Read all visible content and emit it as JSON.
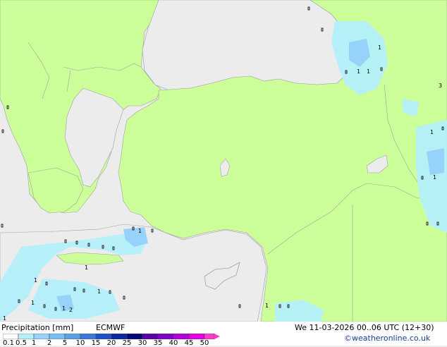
{
  "legend": {
    "title": "Precipitation [mm]",
    "model": "ECMWF",
    "datetime": "We 11-03-2026 00..06 UTC (12+30)",
    "credit": "©weatheronline.co.uk",
    "ticks": [
      "0.1",
      "0.5",
      "1",
      "2",
      "5",
      "10",
      "15",
      "20",
      "25",
      "30",
      "35",
      "40",
      "45",
      "50"
    ],
    "colors": [
      "#ffffff",
      "#b4f0fa",
      "#96d2fa",
      "#78bef0",
      "#5aa0e6",
      "#3c78dc",
      "#1e50c8",
      "#0a28a0",
      "#000a78",
      "#5a00aa",
      "#8200c8",
      "#b400dc",
      "#e600e6",
      "#ff3cc8"
    ]
  },
  "map": {
    "land_color": "#ccff99",
    "sea_color": "#ececec",
    "border_color": "#a0a0a0",
    "rain_light_color": "#b4f0fa",
    "rain_mid_color": "#96d2fa",
    "rain_labels": [
      "1",
      "1",
      "1",
      "1",
      "1",
      "1",
      "1",
      "1",
      "1",
      "1",
      "1",
      "1",
      "1",
      "2",
      "3"
    ]
  }
}
